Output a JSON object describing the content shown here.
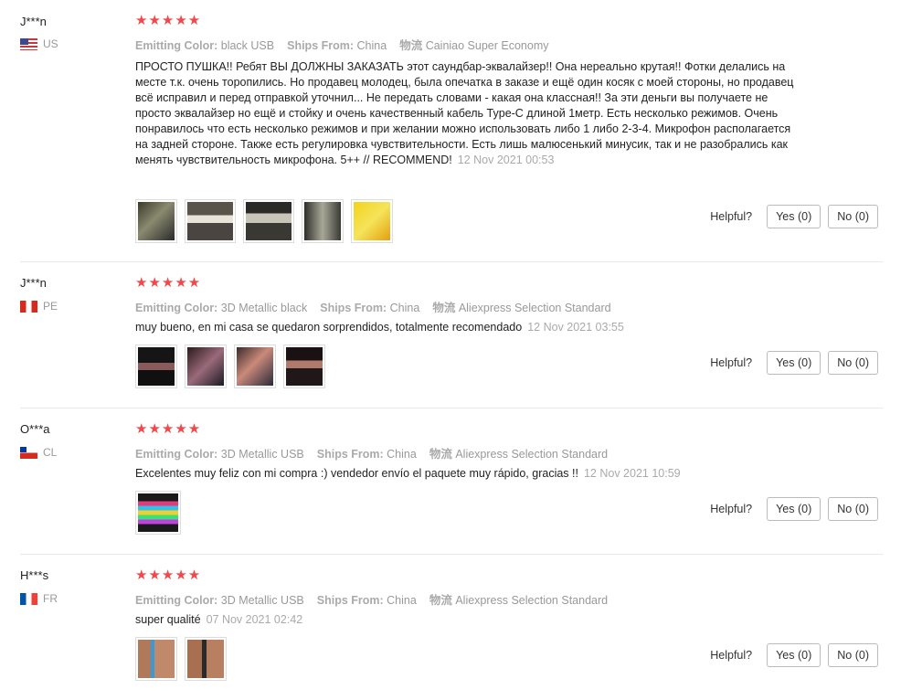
{
  "helpful_label": "Helpful?",
  "reviews": [
    {
      "user": "J***n",
      "country": "US",
      "stars": "★★★★★",
      "attr1_label": "Emitting Color:",
      "attr1_value": "black USB",
      "attr2_label": "Ships From:",
      "attr2_value": "China",
      "attr3_label": "物流",
      "attr3_value": "Cainiao Super Economy",
      "text": "ПРОСТО ПУШКА!! Ребят ВЫ ДОЛЖНЫ ЗАКАЗАТЬ этот саундбар-эквалайзер!! Она нереально крутая!! Фотки делались на месте т.к. очень торопились. Но продавец молодец, была опечатка в заказе и ещё один косяк с моей стороны, но продавец всё исправил и перед отправкой уточнил... Не передать словами - какая она классная!! За эти деньги вы получаете не просто эквалайзер но ещё и стойку и очень качественный кабель Type-C длиной 1метр. Есть несколько режимов. Очень понравилось что есть несколько режимов и при желании можно использовать либо 1 либо 2-3-4. Микрофон располагается на задней стороне. Также есть регулировка чувствительности. Есть лишь малюсенький минусик, так и не разобрались как менять чувствительность микрофона. 5++ // RECOMMEND!",
      "date": "12 Nov 2021 00:53",
      "yes": "Yes (0)",
      "no": "No (0)"
    },
    {
      "user": "J***n",
      "country": "PE",
      "stars": "★★★★★",
      "attr1_label": "Emitting Color:",
      "attr1_value": "3D Metallic black",
      "attr2_label": "Ships From:",
      "attr2_value": "China",
      "attr3_label": "物流",
      "attr3_value": "Aliexpress Selection Standard",
      "text": "muy bueno, en mi casa se quedaron sorprendidos, totalmente recomendado",
      "date": "12 Nov 2021 03:55",
      "yes": "Yes (0)",
      "no": "No (0)"
    },
    {
      "user": "O***a",
      "country": "CL",
      "stars": "★★★★★",
      "attr1_label": "Emitting Color:",
      "attr1_value": "3D Metallic USB",
      "attr2_label": "Ships From:",
      "attr2_value": "China",
      "attr3_label": "物流",
      "attr3_value": "Aliexpress Selection Standard",
      "text": "Excelentes muy feliz con mi compra :) vendedor envío el paquete muy rápido, gracias !!",
      "date": "12 Nov 2021 10:59",
      "yes": "Yes (0)",
      "no": "No (0)"
    },
    {
      "user": "H***s",
      "country": "FR",
      "stars": "★★★★★",
      "attr1_label": "Emitting Color:",
      "attr1_value": "3D Metallic USB",
      "attr2_label": "Ships From:",
      "attr2_value": "China",
      "attr3_label": "物流",
      "attr3_value": "Aliexpress Selection Standard",
      "text": "super qualité",
      "date": "07 Nov 2021 02:42",
      "yes": "Yes (0)",
      "no": "No (0)"
    }
  ]
}
